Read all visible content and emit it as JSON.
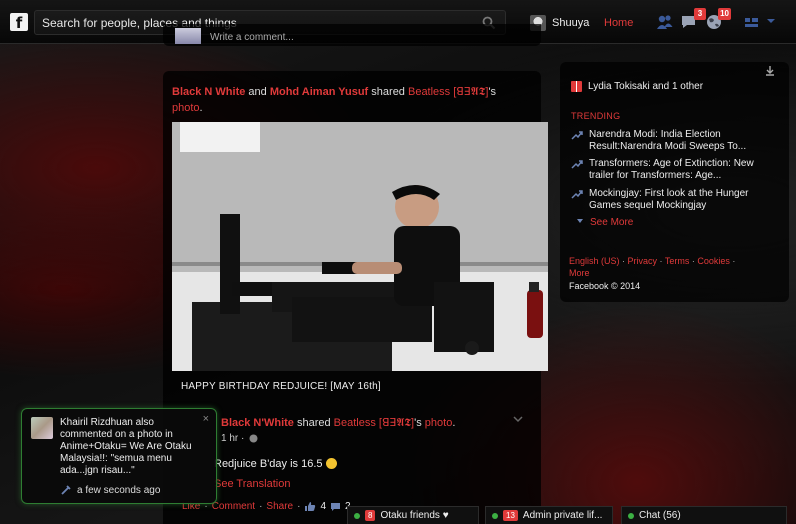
{
  "topbar": {
    "logo": "f",
    "search_placeholder": "Search for people, places and things",
    "username": "Shuuya",
    "home_label": "Home",
    "badges": {
      "messages": "3",
      "notifications": "10"
    }
  },
  "toast": {
    "text": "Khairil Rizdhuan also commented on a photo in Anime+Otaku= We Are Otaku Malaysia!!: \"semua menu ada...jgn risau...\"",
    "close": "×",
    "time": "a few seconds ago"
  },
  "feed": {
    "comment_placeholder": "Write a comment...",
    "story": {
      "actor1": "Black N White",
      "and": " and ",
      "actor2": "Mohd Aiman Yusuf",
      "shared": " shared ",
      "owner": "Beatless [ꓭꓱ𝕬𝕿]",
      "owner_suffix": "'s ",
      "object": "photo",
      "end": "."
    },
    "caption": "HAPPY BIRTHDAY REDJUICE! [MAY 16th]",
    "share": {
      "actor": "Black N'White",
      "shared": " shared ",
      "owner": "Beatless [ꓭꓱ𝕬𝕿]",
      "owner_suffix": "'s ",
      "object": "photo",
      "end": "."
    },
    "meta_time": "1 hr ·",
    "status_text": "Redjuice B'day is 16.5",
    "translation": "See Translation",
    "actions": {
      "like": "Like",
      "comment": "Comment",
      "share": "Share",
      "sep": "·",
      "likes_count": "4",
      "comments_count": "2"
    }
  },
  "sidebar": {
    "birthday": "Lydia Tokisaki and 1 other",
    "trending_label": "TRENDING",
    "trends": [
      "Narendra Modi: India Election Result:Narendra Modi Sweeps To...",
      "Transformers: Age of Extinction: New trailer for Transformers: Age...",
      "Mockingjay: First look at the Hunger Games sequel Mockingjay"
    ],
    "see_more": "See More",
    "footer": {
      "language": "English (US)",
      "privacy": "Privacy",
      "terms": "Terms",
      "cookies": "Cookies",
      "more": "More",
      "sep": " · "
    },
    "copyright": "Facebook © 2014"
  },
  "chat_tabs": [
    {
      "badge": "8",
      "label": "Otaku friends ♥"
    },
    {
      "badge": "13",
      "label": "Admin private lif..."
    },
    {
      "label": "Chat (56)"
    }
  ],
  "colors": {
    "accent": "#e03a3a",
    "online": "#3cb043",
    "toast_border": "#2e7d32"
  }
}
